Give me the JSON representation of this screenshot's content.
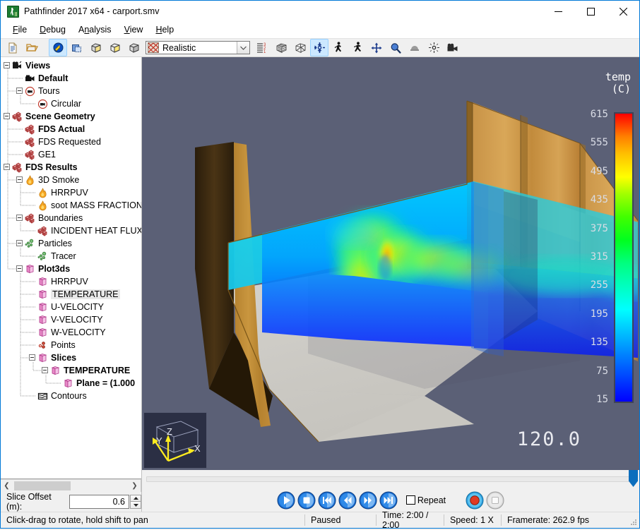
{
  "window": {
    "title": "Pathfinder 2017 x64 - carport.smv",
    "app_icon": "pathfinder-running-man-icon",
    "minimize_label": "—",
    "maximize_label": "□",
    "close_label": "✕"
  },
  "menubar": [
    {
      "label": "File",
      "mnemonic": "F"
    },
    {
      "label": "Debug",
      "mnemonic": "D"
    },
    {
      "label": "Analysis",
      "mnemonic": "n"
    },
    {
      "label": "View",
      "mnemonic": "V"
    },
    {
      "label": "Help",
      "mnemonic": "H"
    }
  ],
  "toolbar": {
    "buttons": [
      {
        "name": "new-document-icon",
        "selected": false
      },
      {
        "name": "open-folder-icon",
        "selected": false
      },
      {
        "name": "render-mode-icon",
        "selected": true
      },
      {
        "name": "blueprint-view-icon",
        "selected": false
      },
      {
        "name": "box-shaded-icon",
        "selected": false
      },
      {
        "name": "box-yellow-icon",
        "selected": false
      },
      {
        "name": "box-gray-icon",
        "selected": false
      }
    ],
    "render_mode": {
      "value": "Realistic",
      "icon": "texture-swatch-icon"
    },
    "buttons2": [
      {
        "name": "layers-order-icon",
        "selected": false
      },
      {
        "name": "wireframe-mesh-icon",
        "selected": false
      },
      {
        "name": "wireframe-outline-icon",
        "selected": false
      },
      {
        "name": "orbit-tool-icon",
        "selected": true
      },
      {
        "name": "walk-person-icon",
        "selected": false
      },
      {
        "name": "run-person-icon",
        "selected": false
      },
      {
        "name": "pan-tool-icon",
        "selected": false
      },
      {
        "name": "zoom-magnifier-icon",
        "selected": false
      },
      {
        "name": "dome-view-icon",
        "selected": false
      },
      {
        "name": "center-target-icon",
        "selected": false
      },
      {
        "name": "camera-movie-icon",
        "selected": false
      }
    ]
  },
  "tree": {
    "items": [
      {
        "id": "views",
        "label": "Views",
        "depth": 0,
        "bold": true,
        "icon": "camera-icon",
        "expander": "minus"
      },
      {
        "id": "default",
        "label": "Default",
        "depth": 1,
        "bold": true,
        "icon": "camera-solid-icon",
        "expander": "none"
      },
      {
        "id": "tours",
        "label": "Tours",
        "depth": 1,
        "bold": false,
        "icon": "tour-circle-icon",
        "expander": "minus"
      },
      {
        "id": "circular",
        "label": "Circular",
        "depth": 2,
        "bold": false,
        "icon": "tour-circle-icon",
        "expander": "none"
      },
      {
        "id": "scene-geometry",
        "label": "Scene Geometry",
        "depth": 0,
        "bold": true,
        "icon": "blocks-icon",
        "expander": "minus"
      },
      {
        "id": "fds-actual",
        "label": "FDS Actual",
        "depth": 1,
        "bold": true,
        "icon": "blocks-icon",
        "expander": "none"
      },
      {
        "id": "fds-requested",
        "label": "FDS Requested",
        "depth": 1,
        "bold": false,
        "icon": "blocks-icon",
        "expander": "none"
      },
      {
        "id": "ge1",
        "label": "GE1",
        "depth": 1,
        "bold": false,
        "icon": "blocks-icon",
        "expander": "none"
      },
      {
        "id": "fds-results",
        "label": "FDS Results",
        "depth": 0,
        "bold": true,
        "icon": "blocks-icon",
        "expander": "minus"
      },
      {
        "id": "3d-smoke",
        "label": "3D Smoke",
        "depth": 1,
        "bold": false,
        "icon": "flame-icon",
        "expander": "minus"
      },
      {
        "id": "hrrpuv-smoke",
        "label": "HRRPUV",
        "depth": 2,
        "bold": false,
        "icon": "flame-icon",
        "expander": "none"
      },
      {
        "id": "soot-mass-fraction",
        "label": "soot MASS FRACTION",
        "depth": 2,
        "bold": false,
        "icon": "flame-icon",
        "expander": "none"
      },
      {
        "id": "boundaries",
        "label": "Boundaries",
        "depth": 1,
        "bold": false,
        "icon": "blocks-icon",
        "expander": "minus"
      },
      {
        "id": "incident-heat-flux",
        "label": "INCIDENT HEAT FLUX",
        "depth": 2,
        "bold": false,
        "icon": "blocks-icon",
        "expander": "none"
      },
      {
        "id": "particles",
        "label": "Particles",
        "depth": 1,
        "bold": false,
        "icon": "particles-icon",
        "expander": "minus"
      },
      {
        "id": "tracer",
        "label": "Tracer",
        "depth": 2,
        "bold": false,
        "icon": "particles-icon",
        "expander": "none"
      },
      {
        "id": "plot3ds",
        "label": "Plot3ds",
        "depth": 1,
        "bold": true,
        "icon": "slice-plane-icon",
        "expander": "minus"
      },
      {
        "id": "hrrpuv-plot3d",
        "label": "HRRPUV",
        "depth": 2,
        "bold": false,
        "icon": "slice-plane-icon",
        "expander": "none"
      },
      {
        "id": "temperature-plot3d",
        "label": "TEMPERATURE",
        "depth": 2,
        "bold": false,
        "icon": "slice-plane-icon",
        "expander": "none",
        "highlight": true
      },
      {
        "id": "u-velocity",
        "label": "U-VELOCITY",
        "depth": 2,
        "bold": false,
        "icon": "slice-plane-icon",
        "expander": "none"
      },
      {
        "id": "v-velocity",
        "label": "V-VELOCITY",
        "depth": 2,
        "bold": false,
        "icon": "slice-plane-icon",
        "expander": "none"
      },
      {
        "id": "w-velocity",
        "label": "W-VELOCITY",
        "depth": 2,
        "bold": false,
        "icon": "slice-plane-icon",
        "expander": "none"
      },
      {
        "id": "points",
        "label": "Points",
        "depth": 2,
        "bold": false,
        "icon": "points-icon",
        "expander": "none"
      },
      {
        "id": "slices",
        "label": "Slices",
        "depth": 2,
        "bold": true,
        "icon": "slice-plane-icon",
        "expander": "minus"
      },
      {
        "id": "slices-temperature",
        "label": "TEMPERATURE",
        "depth": 3,
        "bold": true,
        "icon": "slice-plane-icon",
        "expander": "minus"
      },
      {
        "id": "plane",
        "label": "Plane = (1.000",
        "depth": 4,
        "bold": true,
        "icon": "slice-plane-icon",
        "expander": "none"
      },
      {
        "id": "contours",
        "label": "Contours",
        "depth": 2,
        "bold": false,
        "icon": "contours-icon",
        "expander": "none"
      }
    ]
  },
  "slice_offset": {
    "label": "Slice Offset (m):",
    "value": "0.6",
    "up_label": "▲",
    "down_label": "▼"
  },
  "viewport": {
    "time_display": "120.0",
    "background_color": "#5b6076",
    "axes": {
      "x": "X",
      "y": "Y",
      "z": "Z"
    },
    "colorbar": {
      "title_line1": "temp",
      "title_line2": "(C)",
      "ticks": [
        "615",
        "555",
        "495",
        "435",
        "375",
        "315",
        "255",
        "195",
        "135",
        "75",
        "15"
      ],
      "min": 15,
      "max": 615
    }
  },
  "playback": {
    "buttons": [
      {
        "name": "play-button",
        "glyph": "play"
      },
      {
        "name": "stop-button",
        "glyph": "stop"
      },
      {
        "name": "skip-to-start-button",
        "glyph": "skip-back"
      },
      {
        "name": "step-back-button",
        "glyph": "rewind"
      },
      {
        "name": "step-forward-button",
        "glyph": "fast-forward"
      },
      {
        "name": "skip-to-end-button",
        "glyph": "skip-forward"
      }
    ],
    "repeat_label": "Repeat",
    "repeat_checked": false,
    "record_button": "record-button",
    "record_stop_button": "record-stop-button"
  },
  "statusbar": {
    "hint": "Click-drag to rotate, hold shift to pan",
    "state": "Paused",
    "time": "Time: 2:00 / 2:00",
    "speed": "Speed: 1 X",
    "framerate": "Framerate: 262.9 fps"
  },
  "colors": {
    "accent": "#0078d7",
    "viewport_bg": "#5b6076",
    "wood": "#c08a3e",
    "floor": "#cfcdc8"
  }
}
